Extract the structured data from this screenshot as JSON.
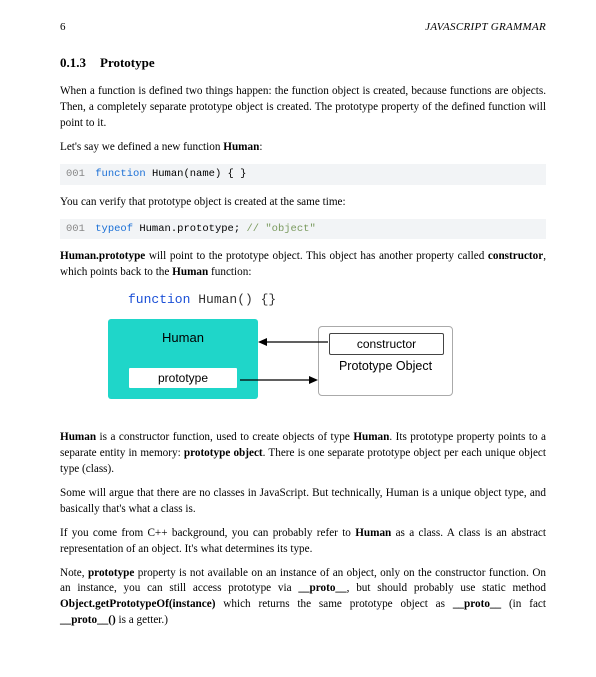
{
  "header": {
    "page_number": "6",
    "running_title": "JAVASCRIPT GRAMMAR"
  },
  "section": {
    "number": "0.1.3",
    "title": "Prototype"
  },
  "paragraphs": {
    "p1": "When a function is defined two things happen: the function object is created, because functions are objects. Then, a completely separate prototype object is created. The prototype property of the defined function will point to it.",
    "p2a": "Let's say we defined a new function ",
    "p2b": "Human",
    "p2c": ":",
    "p3": "You can verify that prototype object is created at the same time:",
    "p4a": "Human.prototype",
    "p4b": " will point to the prototype object. This object has another property called ",
    "p4c": "constructor",
    "p4d": ", which points back to the ",
    "p4e": "Human",
    "p4f": " function:",
    "p5a": "Human",
    "p5b": " is a constructor function, used to create objects of type ",
    "p5c": "Human",
    "p5d": ". Its prototype property points to a separate entity in memory: ",
    "p5e": "prototype object",
    "p5f": ". There is one separate prototype object per each unique object type (class).",
    "p6": "Some will argue that there are no classes in JavaScript. But technically, Human is a unique object type, and basically that's what a class is.",
    "p7a": "If you come from C++ background, you can probably refer to ",
    "p7b": "Human",
    "p7c": " as a class. A class is an abstract representation of an object. It's what determines its type.",
    "p8a": "Note, ",
    "p8b": "prototype",
    "p8c": " property is not available on an instance of an object, only on the constructor function. On an instance, you can still access prototype via ",
    "p8d": "__proto__",
    "p8e": ", but should probably use static method ",
    "p8f": "Object.getPrototypeOf(instance)",
    "p8g": " which returns the same prototype object as ",
    "p8h": "__proto__",
    "p8i": " (in fact ",
    "p8j": "__proto__()",
    "p8k": " is a getter.)"
  },
  "code1": {
    "ln": "001",
    "kw": "function",
    "rest": " Human(name) { }"
  },
  "code2": {
    "ln": "001",
    "kw": "typeof",
    "rest": " Human.prototype; ",
    "comment": "// \"object\""
  },
  "diagram": {
    "fn_kw": "function",
    "fn_rest": " Human() {}",
    "human_label": "Human",
    "prototype_slot": "prototype",
    "constructor_slot": "constructor",
    "proto_obj_label": "Prototype\nObject"
  }
}
